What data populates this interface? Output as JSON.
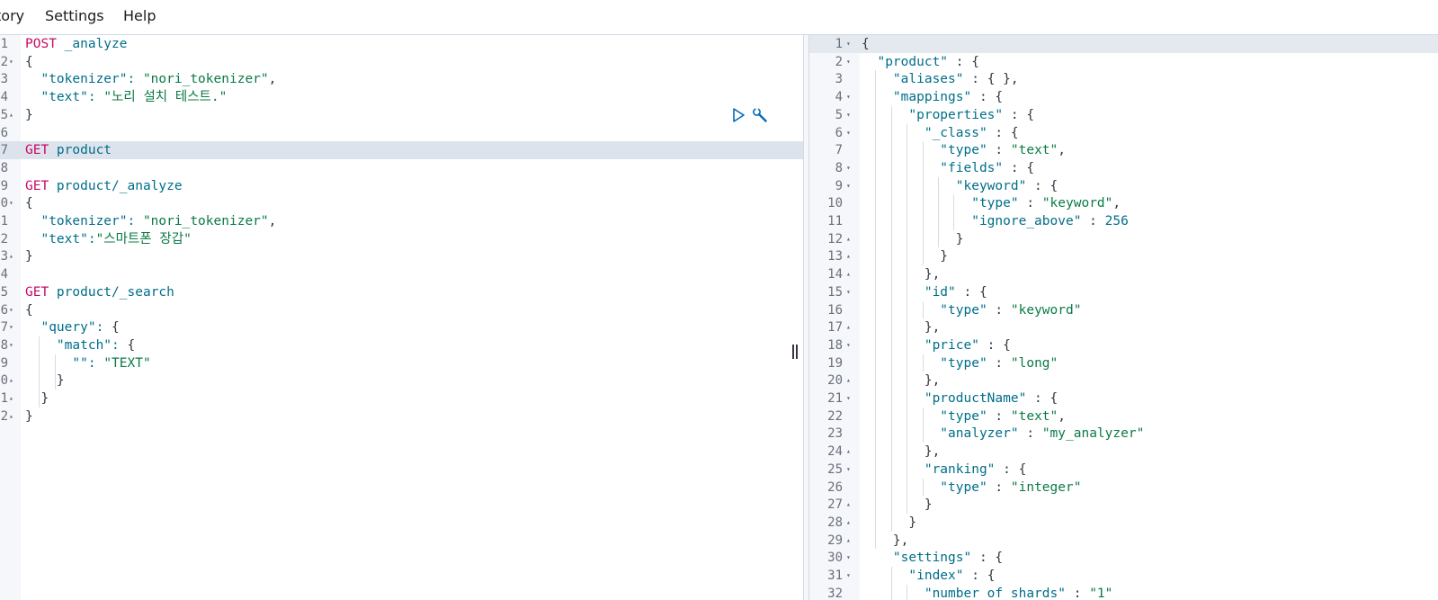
{
  "menu": {
    "items": [
      {
        "label": "tory"
      },
      {
        "label": "Settings"
      },
      {
        "label": "Help"
      }
    ]
  },
  "colors": {
    "keyword": "#c80a68",
    "url": "#006e8a",
    "string": "#0b7a45",
    "number": "#006e8a",
    "punct": "#343741",
    "active_line": "#dde3ec"
  },
  "icons": {
    "run": "play-icon",
    "settings": "wrench-icon",
    "divider": "resize-handle-icon"
  },
  "request_editor": {
    "lines": [
      {
        "num": "1",
        "fold": "",
        "tokens": [
          {
            "t": "POST",
            "c": "k"
          },
          {
            "t": " _analyze",
            "c": "u"
          }
        ]
      },
      {
        "num": "2",
        "fold": "▾",
        "tokens": [
          {
            "t": "{",
            "c": "p"
          }
        ]
      },
      {
        "num": "3",
        "fold": "",
        "tokens": [
          {
            "t": "  \"tokenizer\": ",
            "c": "u"
          },
          {
            "t": "\"nori_tokenizer\"",
            "c": "s"
          },
          {
            "t": ",",
            "c": "p"
          }
        ]
      },
      {
        "num": "4",
        "fold": "",
        "tokens": [
          {
            "t": "  \"text\": ",
            "c": "u"
          },
          {
            "t": "\"노리 설치 테스트.\"",
            "c": "s"
          }
        ]
      },
      {
        "num": "5",
        "fold": "▴",
        "tokens": [
          {
            "t": "}",
            "c": "p"
          }
        ]
      },
      {
        "num": "6",
        "fold": "",
        "tokens": []
      },
      {
        "num": "7",
        "fold": "",
        "active": true,
        "tokens": [
          {
            "t": "GET",
            "c": "k"
          },
          {
            "t": " product",
            "c": "u"
          }
        ]
      },
      {
        "num": "8",
        "fold": "",
        "tokens": []
      },
      {
        "num": "9",
        "fold": "",
        "tokens": [
          {
            "t": "GET",
            "c": "k"
          },
          {
            "t": " product/_analyze",
            "c": "u"
          }
        ]
      },
      {
        "num": "0",
        "fold": "▾",
        "tokens": [
          {
            "t": "{",
            "c": "p"
          }
        ]
      },
      {
        "num": "1",
        "fold": "",
        "tokens": [
          {
            "t": "  \"tokenizer\": ",
            "c": "u"
          },
          {
            "t": "\"nori_tokenizer\"",
            "c": "s"
          },
          {
            "t": ",",
            "c": "p"
          }
        ]
      },
      {
        "num": "2",
        "fold": "",
        "tokens": [
          {
            "t": "  \"text\":",
            "c": "u"
          },
          {
            "t": "\"스마트폰 장갑\"",
            "c": "s"
          }
        ]
      },
      {
        "num": "3",
        "fold": "▴",
        "tokens": [
          {
            "t": "}",
            "c": "p"
          }
        ]
      },
      {
        "num": "4",
        "fold": "",
        "tokens": []
      },
      {
        "num": "5",
        "fold": "",
        "tokens": [
          {
            "t": "GET",
            "c": "k"
          },
          {
            "t": " product/_search",
            "c": "u"
          }
        ]
      },
      {
        "num": "6",
        "fold": "▾",
        "tokens": [
          {
            "t": "{",
            "c": "p"
          }
        ]
      },
      {
        "num": "7",
        "fold": "▾",
        "tokens": [
          {
            "t": "  \"query\": ",
            "c": "u"
          },
          {
            "t": "{",
            "c": "p"
          }
        ]
      },
      {
        "num": "8",
        "fold": "▾",
        "tokens": [
          {
            "t": "    \"match\": ",
            "c": "u"
          },
          {
            "t": "{",
            "c": "p"
          }
        ]
      },
      {
        "num": "9",
        "fold": "",
        "tokens": [
          {
            "t": "      \"\": ",
            "c": "u"
          },
          {
            "t": "\"TEXT\"",
            "c": "s"
          }
        ]
      },
      {
        "num": "0",
        "fold": "▴",
        "tokens": [
          {
            "t": "    }",
            "c": "p"
          }
        ]
      },
      {
        "num": "1",
        "fold": "▴",
        "tokens": [
          {
            "t": "  }",
            "c": "p"
          }
        ]
      },
      {
        "num": "2",
        "fold": "▴",
        "tokens": [
          {
            "t": "}",
            "c": "p"
          }
        ]
      }
    ]
  },
  "response_viewer": {
    "lines": [
      {
        "num": "1",
        "fold": "▾",
        "tokens": [
          {
            "t": "{",
            "c": "p"
          }
        ]
      },
      {
        "num": "2",
        "fold": "▾",
        "tokens": [
          {
            "t": "  \"product\"",
            "c": "u"
          },
          {
            "t": " : {",
            "c": "p"
          }
        ]
      },
      {
        "num": "3",
        "fold": "",
        "tokens": [
          {
            "t": "    \"aliases\"",
            "c": "u"
          },
          {
            "t": " : { },",
            "c": "p"
          }
        ]
      },
      {
        "num": "4",
        "fold": "▾",
        "tokens": [
          {
            "t": "    \"mappings\"",
            "c": "u"
          },
          {
            "t": " : {",
            "c": "p"
          }
        ]
      },
      {
        "num": "5",
        "fold": "▾",
        "tokens": [
          {
            "t": "      \"properties\"",
            "c": "u"
          },
          {
            "t": " : {",
            "c": "p"
          }
        ]
      },
      {
        "num": "6",
        "fold": "▾",
        "tokens": [
          {
            "t": "        \"_class\"",
            "c": "u"
          },
          {
            "t": " : {",
            "c": "p"
          }
        ]
      },
      {
        "num": "7",
        "fold": "",
        "tokens": [
          {
            "t": "          \"type\"",
            "c": "u"
          },
          {
            "t": " : ",
            "c": "p"
          },
          {
            "t": "\"text\"",
            "c": "s"
          },
          {
            "t": ",",
            "c": "p"
          }
        ]
      },
      {
        "num": "8",
        "fold": "▾",
        "tokens": [
          {
            "t": "          \"fields\"",
            "c": "u"
          },
          {
            "t": " : {",
            "c": "p"
          }
        ]
      },
      {
        "num": "9",
        "fold": "▾",
        "tokens": [
          {
            "t": "            \"keyword\"",
            "c": "u"
          },
          {
            "t": " : {",
            "c": "p"
          }
        ]
      },
      {
        "num": "10",
        "fold": "",
        "tokens": [
          {
            "t": "              \"type\"",
            "c": "u"
          },
          {
            "t": " : ",
            "c": "p"
          },
          {
            "t": "\"keyword\"",
            "c": "s"
          },
          {
            "t": ",",
            "c": "p"
          }
        ]
      },
      {
        "num": "11",
        "fold": "",
        "tokens": [
          {
            "t": "              \"ignore_above\"",
            "c": "u"
          },
          {
            "t": " : ",
            "c": "p"
          },
          {
            "t": "256",
            "c": "n"
          }
        ]
      },
      {
        "num": "12",
        "fold": "▴",
        "tokens": [
          {
            "t": "            }",
            "c": "p"
          }
        ]
      },
      {
        "num": "13",
        "fold": "▴",
        "tokens": [
          {
            "t": "          }",
            "c": "p"
          }
        ]
      },
      {
        "num": "14",
        "fold": "▴",
        "tokens": [
          {
            "t": "        },",
            "c": "p"
          }
        ]
      },
      {
        "num": "15",
        "fold": "▾",
        "tokens": [
          {
            "t": "        \"id\"",
            "c": "u"
          },
          {
            "t": " : {",
            "c": "p"
          }
        ]
      },
      {
        "num": "16",
        "fold": "",
        "tokens": [
          {
            "t": "          \"type\"",
            "c": "u"
          },
          {
            "t": " : ",
            "c": "p"
          },
          {
            "t": "\"keyword\"",
            "c": "s"
          }
        ]
      },
      {
        "num": "17",
        "fold": "▴",
        "tokens": [
          {
            "t": "        },",
            "c": "p"
          }
        ]
      },
      {
        "num": "18",
        "fold": "▾",
        "tokens": [
          {
            "t": "        \"price\"",
            "c": "u"
          },
          {
            "t": " : {",
            "c": "p"
          }
        ]
      },
      {
        "num": "19",
        "fold": "",
        "tokens": [
          {
            "t": "          \"type\"",
            "c": "u"
          },
          {
            "t": " : ",
            "c": "p"
          },
          {
            "t": "\"long\"",
            "c": "s"
          }
        ]
      },
      {
        "num": "20",
        "fold": "▴",
        "tokens": [
          {
            "t": "        },",
            "c": "p"
          }
        ]
      },
      {
        "num": "21",
        "fold": "▾",
        "tokens": [
          {
            "t": "        \"productName\"",
            "c": "u"
          },
          {
            "t": " : {",
            "c": "p"
          }
        ]
      },
      {
        "num": "22",
        "fold": "",
        "tokens": [
          {
            "t": "          \"type\"",
            "c": "u"
          },
          {
            "t": " : ",
            "c": "p"
          },
          {
            "t": "\"text\"",
            "c": "s"
          },
          {
            "t": ",",
            "c": "p"
          }
        ]
      },
      {
        "num": "23",
        "fold": "",
        "tokens": [
          {
            "t": "          \"analyzer\"",
            "c": "u"
          },
          {
            "t": " : ",
            "c": "p"
          },
          {
            "t": "\"my_analyzer\"",
            "c": "s"
          }
        ]
      },
      {
        "num": "24",
        "fold": "▴",
        "tokens": [
          {
            "t": "        },",
            "c": "p"
          }
        ]
      },
      {
        "num": "25",
        "fold": "▾",
        "tokens": [
          {
            "t": "        \"ranking\"",
            "c": "u"
          },
          {
            "t": " : {",
            "c": "p"
          }
        ]
      },
      {
        "num": "26",
        "fold": "",
        "tokens": [
          {
            "t": "          \"type\"",
            "c": "u"
          },
          {
            "t": " : ",
            "c": "p"
          },
          {
            "t": "\"integer\"",
            "c": "s"
          }
        ]
      },
      {
        "num": "27",
        "fold": "▴",
        "tokens": [
          {
            "t": "        }",
            "c": "p"
          }
        ]
      },
      {
        "num": "28",
        "fold": "▴",
        "tokens": [
          {
            "t": "      }",
            "c": "p"
          }
        ]
      },
      {
        "num": "29",
        "fold": "▴",
        "tokens": [
          {
            "t": "    },",
            "c": "p"
          }
        ]
      },
      {
        "num": "30",
        "fold": "▾",
        "tokens": [
          {
            "t": "    \"settings\"",
            "c": "u"
          },
          {
            "t": " : {",
            "c": "p"
          }
        ]
      },
      {
        "num": "31",
        "fold": "▾",
        "tokens": [
          {
            "t": "      \"index\"",
            "c": "u"
          },
          {
            "t": " : {",
            "c": "p"
          }
        ]
      },
      {
        "num": "32",
        "fold": "",
        "tokens": [
          {
            "t": "        \"number_of_shards\"",
            "c": "u"
          },
          {
            "t": " : ",
            "c": "p"
          },
          {
            "t": "\"1\"",
            "c": "s"
          }
        ]
      }
    ]
  }
}
